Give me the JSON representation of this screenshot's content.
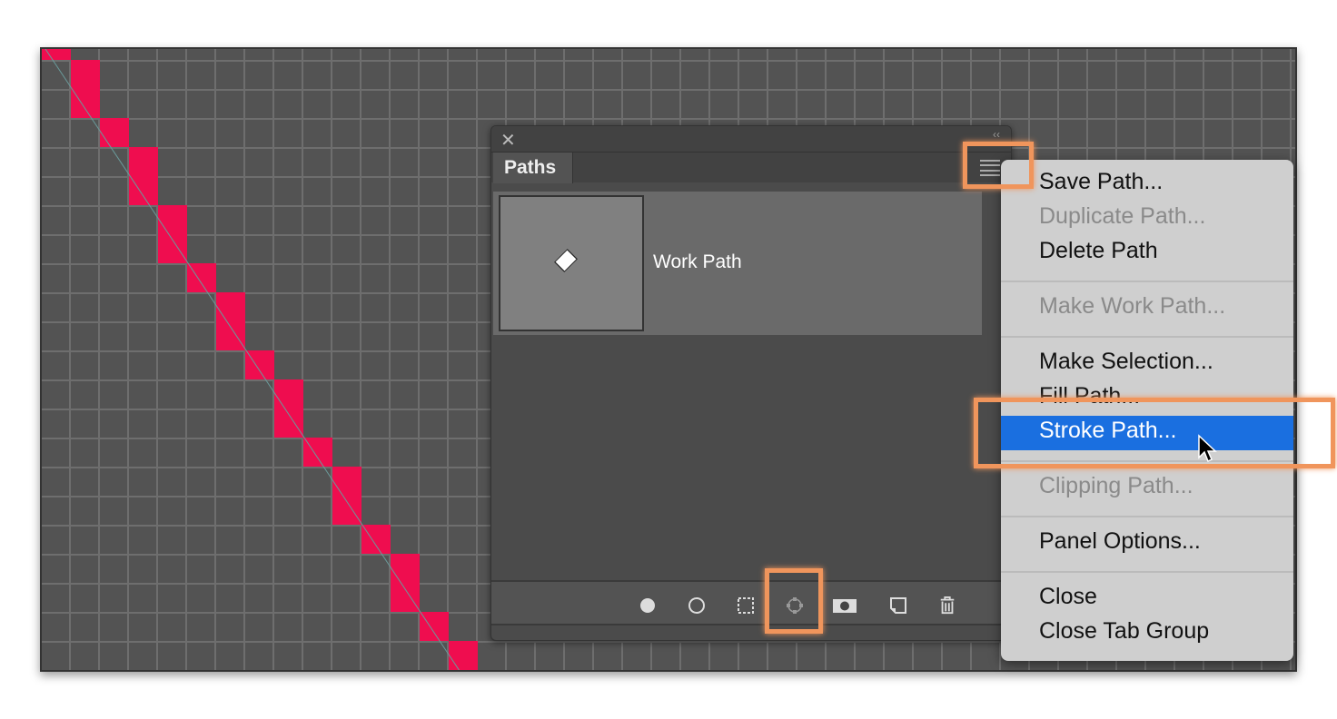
{
  "panel": {
    "title": "Paths",
    "close_icon": "close-icon",
    "collapse_icon": "collapse-icon",
    "menu_icon": "menu-icon",
    "paths": [
      {
        "name": "Work Path"
      }
    ],
    "footer_buttons": [
      {
        "name": "fill-path",
        "icon": "filled-circle-icon"
      },
      {
        "name": "stroke-path",
        "icon": "circle-outline-icon"
      },
      {
        "name": "load-selection",
        "icon": "dashed-square-icon"
      },
      {
        "name": "make-work-path",
        "icon": "path-anchor-icon"
      },
      {
        "name": "add-mask",
        "icon": "mask-icon"
      },
      {
        "name": "new-path",
        "icon": "new-page-icon"
      },
      {
        "name": "delete-path",
        "icon": "trash-icon"
      }
    ]
  },
  "menu": {
    "groups": [
      [
        {
          "label": "Save Path...",
          "enabled": true
        },
        {
          "label": "Duplicate Path...",
          "enabled": false
        },
        {
          "label": "Delete Path",
          "enabled": true
        }
      ],
      [
        {
          "label": "Make Work Path...",
          "enabled": false
        }
      ],
      [
        {
          "label": "Make Selection...",
          "enabled": true
        },
        {
          "label": "Fill Path...",
          "enabled": true
        },
        {
          "label": "Stroke Path...",
          "enabled": true,
          "selected": true
        }
      ],
      [
        {
          "label": "Clipping Path...",
          "enabled": false
        }
      ],
      [
        {
          "label": "Panel Options...",
          "enabled": true
        }
      ],
      [
        {
          "label": "Close",
          "enabled": true
        },
        {
          "label": "Close Tab Group",
          "enabled": true
        }
      ]
    ]
  },
  "colors": {
    "pixel": "#ef0d4f",
    "highlight": "#f0955c",
    "selection": "#1a6fe0"
  }
}
